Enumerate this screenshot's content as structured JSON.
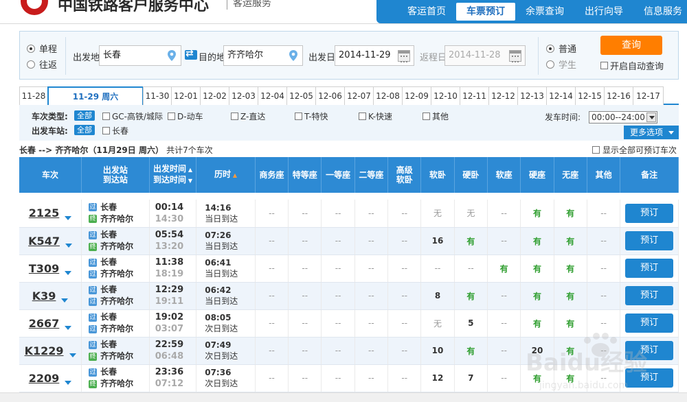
{
  "header": {
    "site_title": "中国铁路客户服务中心",
    "site_sub": "客运服务",
    "nav": [
      {
        "label": "客运首页"
      },
      {
        "label": "车票预订"
      },
      {
        "label": "余票查询"
      },
      {
        "label": "出行向导"
      },
      {
        "label": "信息服务"
      }
    ]
  },
  "search": {
    "trip_oneway": "单程",
    "trip_round": "往返",
    "from_label": "出发地",
    "from_value": "长春",
    "to_label": "目的地",
    "to_value": "齐齐哈尔",
    "depart_label": "出发日",
    "depart_value": "2014-11-29",
    "return_label": "返程日",
    "return_value": "2014-11-28",
    "type_normal": "普通",
    "type_student": "学生",
    "query_label": "查询",
    "auto_query_label": "开启自动查询"
  },
  "dates": [
    "11-28",
    "11-29 周六",
    "11-30",
    "12-01",
    "12-02",
    "12-03",
    "12-04",
    "12-05",
    "12-06",
    "12-07",
    "12-08",
    "12-09",
    "12-10",
    "12-11",
    "12-12",
    "12-13",
    "12-14",
    "12-15",
    "12-16",
    "12-17"
  ],
  "filters": {
    "train_type_label": "车次类型:",
    "station_label": "出发车站:",
    "all_label": "全部",
    "types": [
      "GC-高铁/城际",
      "D-动车",
      "Z-直达",
      "T-特快",
      "K-快速",
      "其他"
    ],
    "station": "长春",
    "time_label": "发车时间:",
    "time_value": "00:00--24:00",
    "more_label": "更多选项"
  },
  "summary": {
    "route": "长春 --> 齐齐哈尔（11月29日 周六）",
    "count": "共计7个车次",
    "show_all": "显示全部可预订车次"
  },
  "table": {
    "headers": {
      "train": "车次",
      "stations_1": "出发站",
      "stations_2": "到达站",
      "time_1": "出发时间",
      "time_2": "到达时间",
      "duration": "历时",
      "business": "商务座",
      "special": "特等座",
      "first": "一等座",
      "second": "二等座",
      "high_soft_1": "高级",
      "high_soft_2": "软卧",
      "soft_sleeper": "软卧",
      "hard_sleeper": "硬卧",
      "soft_seat": "软座",
      "hard_seat": "硬座",
      "standing": "无座",
      "other": "其他",
      "remark": "备注"
    },
    "pass_tag": "过",
    "end_tag": "终",
    "book_label": "预订",
    "rows": [
      {
        "train": "2125",
        "from": "长春",
        "to": "齐齐哈尔",
        "dep": "00:14",
        "arr": "14:30",
        "dur": "14:16",
        "arrive_day": "当日到达",
        "to_tag": "终",
        "seats": [
          "--",
          "--",
          "--",
          "--",
          "--",
          "无",
          "无",
          "--",
          "有",
          "有",
          "--"
        ]
      },
      {
        "train": "K547",
        "from": "长春",
        "to": "齐齐哈尔",
        "dep": "05:54",
        "arr": "13:20",
        "dur": "07:26",
        "arrive_day": "当日到达",
        "to_tag": "终",
        "seats": [
          "--",
          "--",
          "--",
          "--",
          "--",
          "16",
          "有",
          "--",
          "有",
          "有",
          "--"
        ]
      },
      {
        "train": "T309",
        "from": "长春",
        "to": "齐齐哈尔",
        "dep": "11:38",
        "arr": "18:19",
        "dur": "06:41",
        "arrive_day": "当日到达",
        "to_tag": "过",
        "seats": [
          "--",
          "--",
          "--",
          "--",
          "--",
          "--",
          "--",
          "有",
          "有",
          "有",
          "--"
        ]
      },
      {
        "train": "K39",
        "from": "长春",
        "to": "齐齐哈尔",
        "dep": "12:29",
        "arr": "19:11",
        "dur": "06:42",
        "arrive_day": "当日到达",
        "to_tag": "过",
        "seats": [
          "--",
          "--",
          "--",
          "--",
          "--",
          "8",
          "有",
          "--",
          "有",
          "有",
          "--"
        ]
      },
      {
        "train": "2667",
        "from": "长春",
        "to": "齐齐哈尔",
        "dep": "19:02",
        "arr": "03:07",
        "dur": "08:05",
        "arrive_day": "次日到达",
        "to_tag": "过",
        "seats": [
          "--",
          "--",
          "--",
          "--",
          "--",
          "无",
          "5",
          "--",
          "有",
          "有",
          "--"
        ]
      },
      {
        "train": "K1229",
        "from": "长春",
        "to": "齐齐哈尔",
        "dep": "22:59",
        "arr": "06:48",
        "dur": "07:49",
        "arrive_day": "次日到达",
        "to_tag": "终",
        "seats": [
          "--",
          "--",
          "--",
          "--",
          "--",
          "10",
          "有",
          "--",
          "20",
          "有",
          "--"
        ]
      },
      {
        "train": "2209",
        "from": "长春",
        "to": "齐齐哈尔",
        "dep": "23:36",
        "arr": "07:12",
        "dur": "07:36",
        "arrive_day": "次日到达",
        "to_tag": "终",
        "seats": [
          "--",
          "--",
          "--",
          "--",
          "--",
          "12",
          "7",
          "--",
          "有",
          "有",
          "--"
        ]
      }
    ]
  },
  "watermark": {
    "text": "Baidu经验",
    "url": "jingyan.baidu.com"
  },
  "colors": {
    "brand_blue": "#1f86d0",
    "query_orange": "#ff7e00",
    "available_green": "#2f9e2f"
  }
}
